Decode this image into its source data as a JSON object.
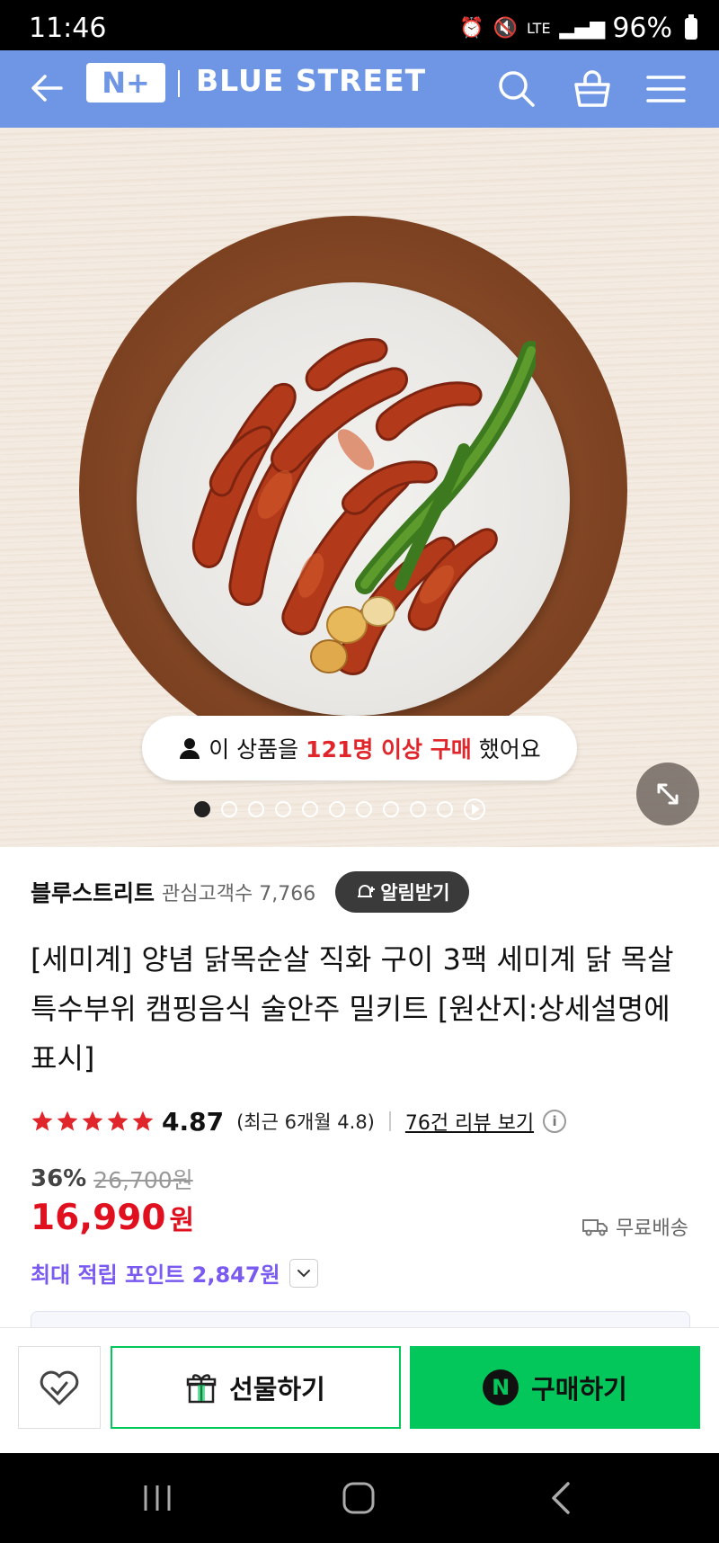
{
  "status_bar": {
    "time": "11:46",
    "network": "LTE",
    "battery": "96%"
  },
  "header": {
    "logo_mark": "N+",
    "logo_text": "BLUE STREET"
  },
  "hero": {
    "buyers_prefix": "이 상품을",
    "buyers_highlight": "121명 이상 구매",
    "buyers_suffix": "했어요",
    "slide_count": 10,
    "active_slide": 1
  },
  "seller": {
    "name": "블루스트리트",
    "followers_label": "관심고객수 7,766",
    "notify_label": "알림받기"
  },
  "product": {
    "title": "[세미계] 양념 닭목순살 직화 구이 3팩 세미계 닭 목살 특수부위 캠핑음식 술안주 밀키트 [원산지:상세설명에 표시]",
    "rating": "4.87",
    "rating_stars": 5,
    "rating_recent": "(최근 6개월 4.8)",
    "review_link": "76건 리뷰 보기",
    "discount": "36%",
    "original_price": "26,700원",
    "price": "16,990",
    "price_unit": "원",
    "shipping": "무료배송",
    "points": "최대 적립 포인트 2,847원"
  },
  "actions": {
    "gift_label": "선물하기",
    "buy_label": "구매하기",
    "buy_badge": "N"
  },
  "colors": {
    "header_bg": "#6f96e4",
    "price_red": "#e0101f",
    "naver_green": "#03c75a",
    "points_purple": "#7a5af0",
    "star_red": "#e0252b"
  }
}
